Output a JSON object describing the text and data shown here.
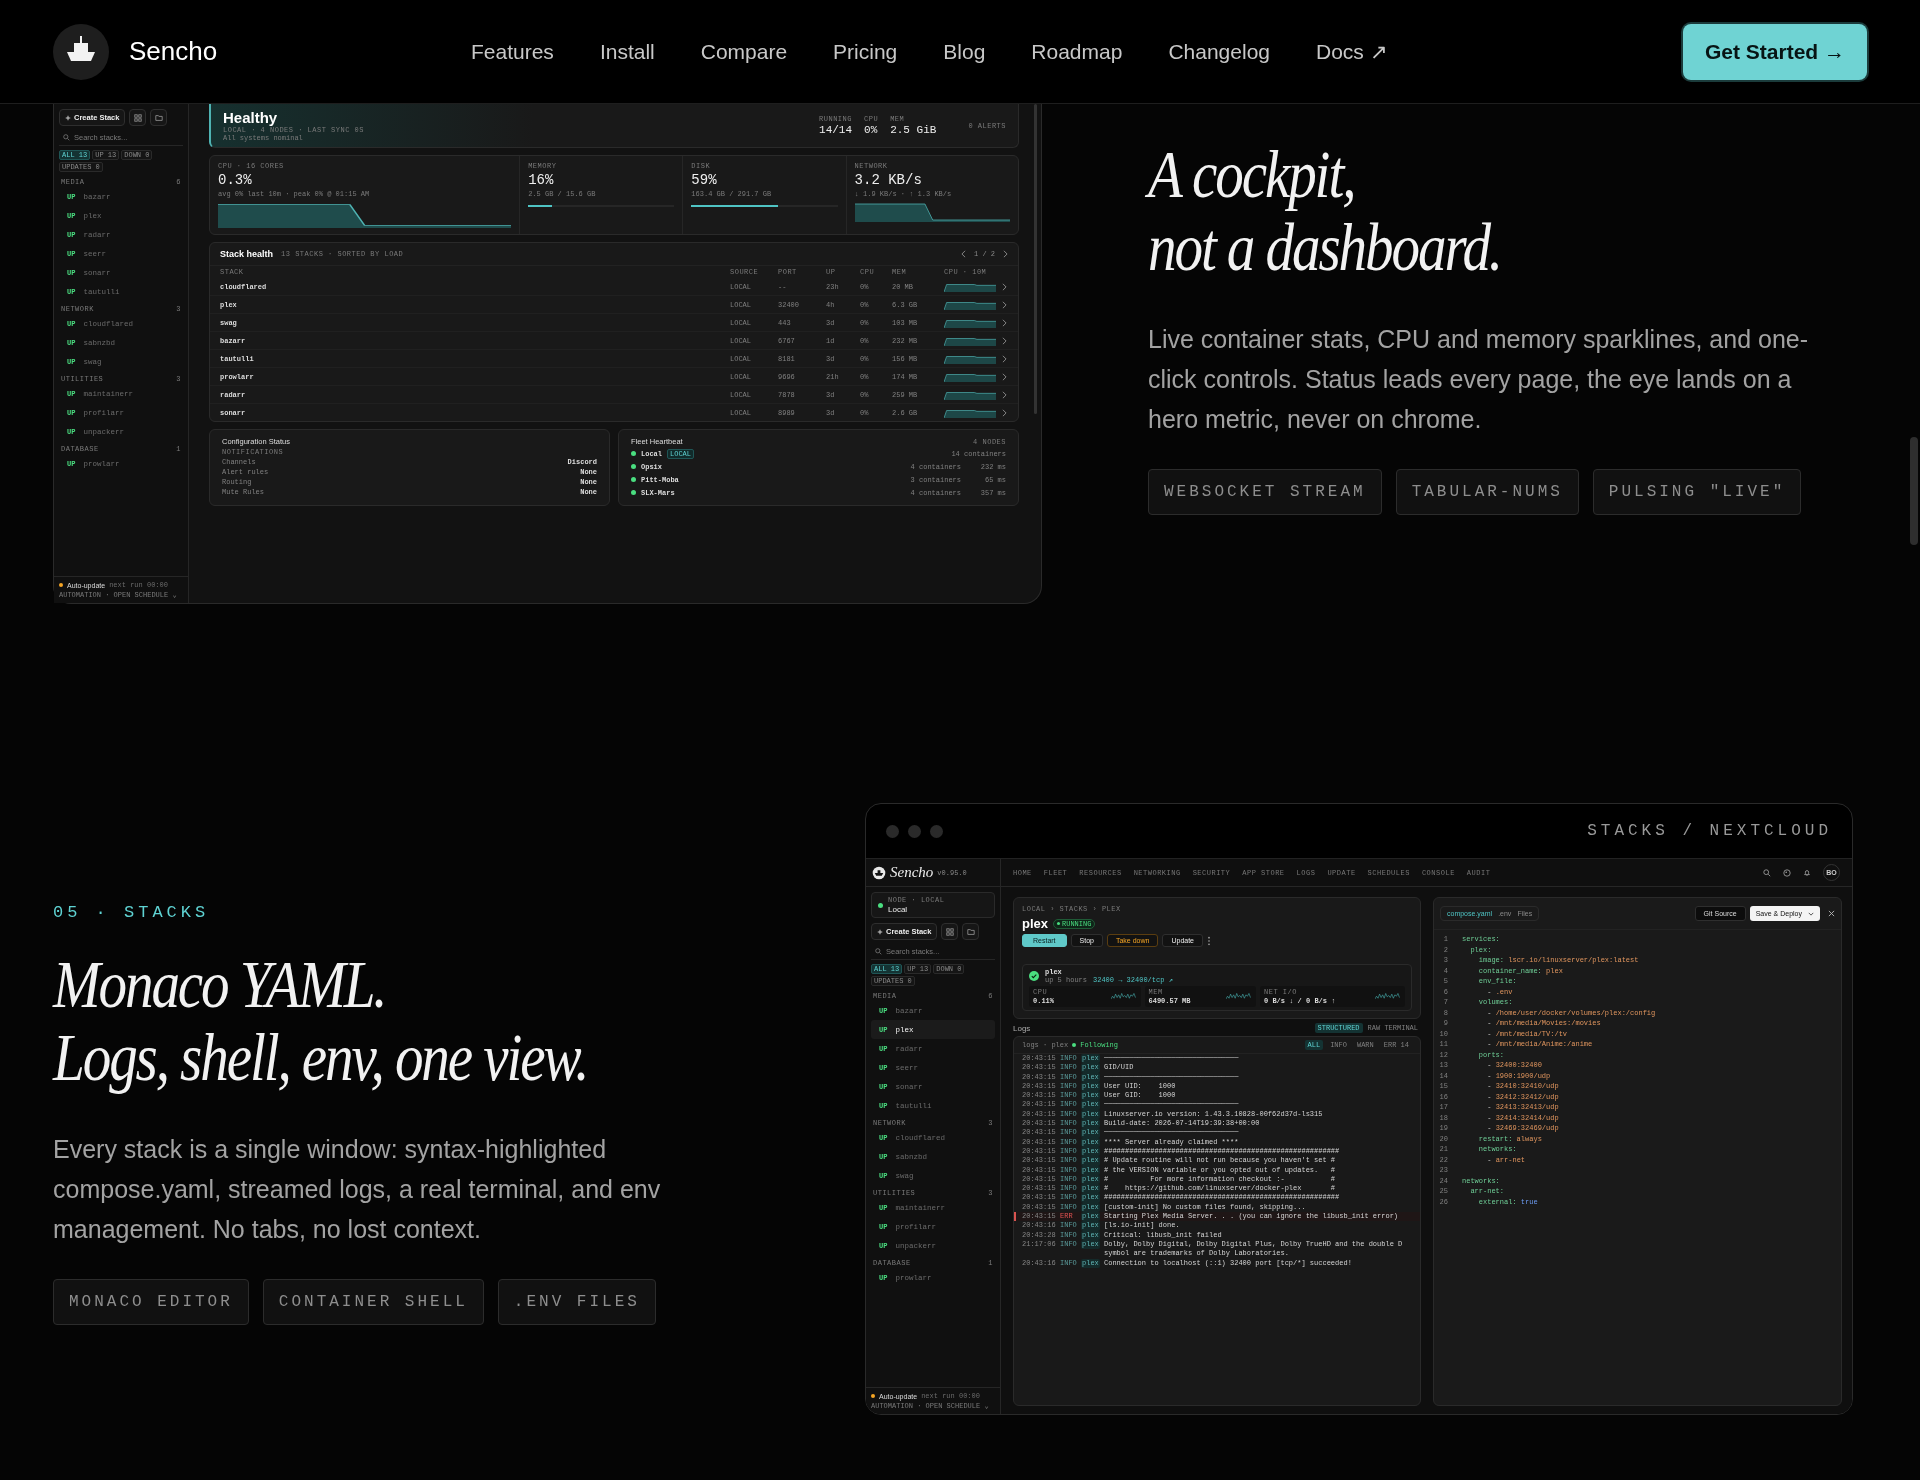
{
  "nav": {
    "brand": "Sencho",
    "links": [
      "Features",
      "Install",
      "Compare",
      "Pricing",
      "Blog",
      "Roadmap",
      "Changelog",
      "Docs ↗"
    ],
    "cta": "Get Started →"
  },
  "realtime": {
    "heading": [
      "A cockpit,",
      "not a dashboard."
    ],
    "body": "Live container stats, CPU and memory sparklines, and one-click controls. Status leads every page, the eye lands on a hero metric, never on chrome.",
    "tags": [
      "WEBSOCKET STREAM",
      "TABULAR-NUMS",
      "PULSING \"LIVE\""
    ],
    "preview": {
      "sidebar": {
        "create": "Create Stack",
        "search": {
          "placeholder": "Search stacks..."
        },
        "filters": [
          {
            "label": "ALL 13",
            "selected": true
          },
          {
            "label": "UP 13",
            "selected": false
          },
          {
            "label": "DOWN 0",
            "selected": false
          },
          {
            "label": "UPDATES 0",
            "selected": false
          }
        ],
        "groups": [
          {
            "name": "MEDIA",
            "count": "6",
            "items": [
              {
                "status": "UP",
                "name": "bazarr",
                "selected": false
              },
              {
                "status": "UP",
                "name": "plex",
                "selected": false
              },
              {
                "status": "UP",
                "name": "radarr",
                "selected": false
              },
              {
                "status": "UP",
                "name": "seerr",
                "selected": false
              },
              {
                "status": "UP",
                "name": "sonarr",
                "selected": false
              },
              {
                "status": "UP",
                "name": "tautulli",
                "selected": false
              }
            ]
          },
          {
            "name": "NETWORK",
            "count": "3",
            "items": [
              {
                "status": "UP",
                "name": "cloudflared",
                "selected": false
              },
              {
                "status": "UP",
                "name": "sabnzbd",
                "selected": false
              },
              {
                "status": "UP",
                "name": "swag",
                "selected": false
              }
            ]
          },
          {
            "name": "UTILITIES",
            "count": "3",
            "items": [
              {
                "status": "UP",
                "name": "maintainerr",
                "selected": false
              },
              {
                "status": "UP",
                "name": "profilarr",
                "selected": false
              },
              {
                "status": "UP",
                "name": "unpackerr",
                "selected": false
              }
            ]
          },
          {
            "name": "DATABASE",
            "count": "1",
            "items": [
              {
                "status": "UP",
                "name": "prowlarr",
                "selected": false
              }
            ]
          }
        ],
        "footer": {
          "title": "Auto-update",
          "next": "next run 00:00",
          "links": "AUTOMATION · OPEN SCHEDULE ⌄"
        }
      },
      "health": {
        "title": "Healthy",
        "meta": "LOCAL · 4 NODES · LAST SYNC 0S",
        "sub": "All systems nominal",
        "stats": [
          {
            "label": "RUNNING",
            "value": "14/14"
          },
          {
            "label": "CPU",
            "value": "0%"
          },
          {
            "label": "MEM",
            "value": "2.5 GiB"
          }
        ],
        "alerts": "0 ALERTS"
      },
      "metrics": [
        {
          "kind": "area",
          "label": "CPU · 16 CORES",
          "value": "0.3%",
          "sub": "avg 0% last 10m · peak 0% @ 01:15 AM"
        },
        {
          "kind": "bar",
          "label": "MEMORY",
          "value": "16%",
          "sub": "2.5 GB / 15.6 GB",
          "level": 0.16
        },
        {
          "kind": "bar",
          "label": "DISK",
          "value": "59%",
          "sub": "163.4 GB / 291.7 GB",
          "level": 0.59
        },
        {
          "kind": "area",
          "label": "NETWORK",
          "value": "3.2 KB/s",
          "sub": "↓ 1.9 KB/s · ↑ 1.3 KB/s"
        }
      ],
      "stack_health": {
        "title": "Stack health",
        "meta": "13 STACKS · SORTED BY LOAD",
        "pager": "1 / 2",
        "columns": [
          "STACK",
          "SOURCE",
          "PORT",
          "UP",
          "CPU",
          "MEM",
          "CPU · 10M"
        ],
        "rows": [
          [
            "cloudflared",
            "LOCAL",
            "--",
            "23h",
            "0%",
            "20 MB"
          ],
          [
            "plex",
            "LOCAL",
            "32400",
            "4h",
            "0%",
            "6.3 GB"
          ],
          [
            "swag",
            "LOCAL",
            "443",
            "3d",
            "0%",
            "103 MB"
          ],
          [
            "bazarr",
            "LOCAL",
            "6767",
            "1d",
            "0%",
            "232 MB"
          ],
          [
            "tautulli",
            "LOCAL",
            "8181",
            "3d",
            "0%",
            "156 MB"
          ],
          [
            "prowlarr",
            "LOCAL",
            "9696",
            "21h",
            "0%",
            "174 MB"
          ],
          [
            "radarr",
            "LOCAL",
            "7878",
            "3d",
            "0%",
            "259 MB"
          ],
          [
            "sonarr",
            "LOCAL",
            "8989",
            "3d",
            "0%",
            "2.6 GB"
          ]
        ]
      },
      "config": {
        "title": "Configuration Status",
        "section": "NOTIFICATIONS",
        "rows": [
          {
            "label": "Channels",
            "value": "Discord"
          },
          {
            "label": "Alert rules",
            "value": "None"
          },
          {
            "label": "Routing",
            "value": "None"
          },
          {
            "label": "Mute Rules",
            "value": "None"
          }
        ]
      },
      "fleet": {
        "title": "Fleet Heartbeat",
        "count": "4 NODES",
        "nodes": [
          {
            "name": "Local",
            "badge": "LOCAL",
            "containers": "14 containers"
          },
          {
            "name": "Opsix",
            "containers": "4 containers",
            "latency": "232 ms"
          },
          {
            "name": "Pitt-Moba",
            "containers": "3 containers",
            "latency": "65 ms"
          },
          {
            "name": "SLX-Mars",
            "containers": "4 containers",
            "latency": "357 ms"
          }
        ]
      }
    }
  },
  "stacks": {
    "kicker": "05 · STACKS",
    "heading": [
      "Monaco YAML.",
      "Logs, shell, env, one view."
    ],
    "body": "Every stack is a single window: syntax-highlighted compose.yaml, streamed logs, a real terminal, and env management. No tabs, no lost context.",
    "tags": [
      "MONACO EDITOR",
      "CONTAINER SHELL",
      ".ENV FILES"
    ],
    "window": {
      "title": "STACKS / NEXTCLOUD",
      "brand": "Sencho",
      "version": "v0.95.0",
      "tabs": [
        "HOME",
        "FLEET",
        "RESOURCES",
        "NETWORKING",
        "SECURITY",
        "APP STORE",
        "LOGS",
        "UPDATE",
        "SCHEDULES",
        "CONSOLE",
        "AUDIT"
      ],
      "avatar": "BO",
      "sidebar": {
        "node_label": "NODE · LOCAL",
        "node": "Local",
        "create": "Create Stack",
        "search": {
          "placeholder": "Search stacks..."
        },
        "filters": [
          {
            "label": "ALL 13",
            "selected": true
          },
          {
            "label": "UP 13",
            "selected": false
          },
          {
            "label": "DOWN 0",
            "selected": false
          },
          {
            "label": "UPDATES 0",
            "selected": false
          }
        ],
        "groups": [
          {
            "name": "MEDIA",
            "count": "6",
            "items": [
              {
                "status": "UP",
                "name": "bazarr",
                "selected": false
              },
              {
                "status": "UP",
                "name": "plex",
                "selected": true
              },
              {
                "status": "UP",
                "name": "radarr",
                "selected": false
              },
              {
                "status": "UP",
                "name": "seerr",
                "selected": false
              },
              {
                "status": "UP",
                "name": "sonarr",
                "selected": false
              },
              {
                "status": "UP",
                "name": "tautulli",
                "selected": false
              }
            ]
          },
          {
            "name": "NETWORK",
            "count": "3",
            "items": [
              {
                "status": "UP",
                "name": "cloudflared",
                "selected": false
              },
              {
                "status": "UP",
                "name": "sabnzbd",
                "selected": false
              },
              {
                "status": "UP",
                "name": "swag",
                "selected": false
              }
            ]
          },
          {
            "name": "UTILITIES",
            "count": "3",
            "items": [
              {
                "status": "UP",
                "name": "maintainerr",
                "selected": false
              },
              {
                "status": "UP",
                "name": "profilarr",
                "selected": false
              },
              {
                "status": "UP",
                "name": "unpackerr",
                "selected": false
              }
            ]
          },
          {
            "name": "DATABASE",
            "count": "1",
            "items": [
              {
                "status": "UP",
                "name": "prowlarr",
                "selected": false
              }
            ]
          }
        ],
        "footer": {
          "title": "Auto-update",
          "next": "next run 00:00",
          "links": "AUTOMATION · OPEN SCHEDULE ⌄"
        }
      },
      "stack": {
        "breadcrumb": "LOCAL › STACKS › PLEX",
        "name": "plex",
        "status": "RUNNING",
        "actions": [
          {
            "label": "Restart",
            "kind": "primary"
          },
          {
            "label": "Stop",
            "kind": "plain"
          },
          {
            "label": "Take down",
            "kind": "warning"
          },
          {
            "label": "Update",
            "kind": "plain"
          }
        ],
        "container": {
          "name": "plex",
          "uptime": "up 5 hours",
          "ports": "32400 → 32400/tcp ↗",
          "metrics": [
            {
              "label": "CPU",
              "value": "0.11%"
            },
            {
              "label": "MEM",
              "value": "6490.57 MB"
            },
            {
              "label": "NET I/O",
              "value": "0 B/s ↓ / 0 B/s ↑"
            }
          ]
        }
      },
      "logs": {
        "title": "Logs",
        "modes": [
          {
            "label": "STRUCTURED",
            "selected": true
          },
          {
            "label": "RAW TERMINAL",
            "selected": false
          }
        ],
        "source": "logs · plex",
        "following": "Following",
        "filters": [
          {
            "label": "ALL",
            "selected": true
          },
          {
            "label": "INFO",
            "selected": false
          },
          {
            "label": "WARN",
            "selected": false
          },
          {
            "label": "ERR 14",
            "selected": false
          }
        ],
        "lines": [
          {
            "time": "20:43:15",
            "severity": "INFO",
            "source": "plex",
            "msg": "────────────────────────────────"
          },
          {
            "time": "20:43:15",
            "severity": "INFO",
            "source": "plex",
            "msg": "GID/UID"
          },
          {
            "time": "20:43:15",
            "severity": "INFO",
            "source": "plex",
            "msg": "────────────────────────────────"
          },
          {
            "time": "20:43:15",
            "severity": "INFO",
            "source": "plex",
            "msg": "User UID:    1000"
          },
          {
            "time": "20:43:15",
            "severity": "INFO",
            "source": "plex",
            "msg": "User GID:    1000"
          },
          {
            "time": "20:43:15",
            "severity": "INFO",
            "source": "plex",
            "msg": "────────────────────────────────"
          },
          {
            "time": "20:43:15",
            "severity": "INFO",
            "source": "plex",
            "msg": "Linuxserver.io version: 1.43.3.10828-00f62d37d-ls315"
          },
          {
            "time": "20:43:15",
            "severity": "INFO",
            "source": "plex",
            "msg": "Build-date: 2026-07-14T19:39:38+00:00"
          },
          {
            "time": "20:43:15",
            "severity": "INFO",
            "source": "plex",
            "msg": "────────────────────────────────"
          },
          {
            "time": "20:43:15",
            "severity": "INFO",
            "source": "plex",
            "msg": "**** Server already claimed ****"
          },
          {
            "time": "20:43:15",
            "severity": "INFO",
            "source": "plex",
            "msg": "########################################################"
          },
          {
            "time": "20:43:15",
            "severity": "INFO",
            "source": "plex",
            "msg": "# Update routine will not run because you haven't set #"
          },
          {
            "time": "20:43:15",
            "severity": "INFO",
            "source": "plex",
            "msg": "# the VERSION variable or you opted out of updates.   #"
          },
          {
            "time": "20:43:15",
            "severity": "INFO",
            "source": "plex",
            "msg": "#          For more information checkout :-           #"
          },
          {
            "time": "20:43:15",
            "severity": "INFO",
            "source": "plex",
            "msg": "#    https://github.com/linuxserver/docker-plex       #"
          },
          {
            "time": "20:43:15",
            "severity": "INFO",
            "source": "plex",
            "msg": "########################################################"
          },
          {
            "time": "20:43:15",
            "severity": "INFO",
            "source": "plex",
            "msg": "[custom-init] No custom files found, skipping..."
          },
          {
            "time": "20:43:15",
            "severity": "ERR",
            "source": "plex",
            "msg": "Starting Plex Media Server. . . (you can ignore the libusb_init error)"
          },
          {
            "time": "20:43:16",
            "severity": "INFO",
            "source": "plex",
            "msg": "[ls.io-init] done."
          },
          {
            "time": "20:43:28",
            "severity": "INFO",
            "source": "plex",
            "msg": "Critical: libusb_init failed"
          },
          {
            "time": "21:17:06",
            "severity": "INFO",
            "source": "plex",
            "msg": "Dolby, Dolby Digital, Dolby Digital Plus, Dolby TrueHD and the double D symbol are trademarks of Dolby Laboratories."
          },
          {
            "time": "20:43:16",
            "severity": "INFO",
            "source": "plex",
            "msg": "Connection to localhost (::1) 32400 port [tcp/*] succeeded!"
          }
        ]
      },
      "editor": {
        "tabs": [
          {
            "label": "compose.yaml",
            "selected": true
          },
          {
            "label": ".env",
            "selected": false
          },
          {
            "label": "Files",
            "selected": false
          }
        ],
        "git": "Git Source",
        "save": "Save & Deploy",
        "lines": [
          {
            "n": "1",
            "kind": "key",
            "code": "services:"
          },
          {
            "n": "2",
            "kind": "key",
            "code": "  plex:"
          },
          {
            "n": "3",
            "kind": "key",
            "code": "    image: lscr.io/linuxserver/plex:latest"
          },
          {
            "n": "4",
            "kind": "key",
            "code": "    container_name: plex"
          },
          {
            "n": "5",
            "kind": "key",
            "code": "    env_file:"
          },
          {
            "n": "6",
            "kind": "item",
            "code": "      - .env"
          },
          {
            "n": "7",
            "kind": "key",
            "code": "    volumes:"
          },
          {
            "n": "8",
            "kind": "item",
            "code": "      - /home/user/docker/volumes/plex:/config"
          },
          {
            "n": "9",
            "kind": "item",
            "code": "      - /mnt/media/Movies:/movies"
          },
          {
            "n": "10",
            "kind": "item",
            "code": "      - /mnt/media/TV:/tv"
          },
          {
            "n": "11",
            "kind": "item",
            "code": "      - /mnt/media/Anime:/anime"
          },
          {
            "n": "12",
            "kind": "key",
            "code": "    ports:"
          },
          {
            "n": "13",
            "kind": "item",
            "code": "      - 32400:32400"
          },
          {
            "n": "14",
            "kind": "item",
            "code": "      - 1900:1900/udp"
          },
          {
            "n": "15",
            "kind": "item",
            "code": "      - 32410:32410/udp"
          },
          {
            "n": "16",
            "kind": "item",
            "code": "      - 32412:32412/udp"
          },
          {
            "n": "17",
            "kind": "item",
            "code": "      - 32413:32413/udp"
          },
          {
            "n": "18",
            "kind": "item",
            "code": "      - 32414:32414/udp"
          },
          {
            "n": "19",
            "kind": "item",
            "code": "      - 32469:32469/udp"
          },
          {
            "n": "20",
            "kind": "key",
            "code": "    restart: always"
          },
          {
            "n": "21",
            "kind": "key",
            "code": "    networks:"
          },
          {
            "n": "22",
            "kind": "item",
            "code": "      - arr-net"
          },
          {
            "n": "23",
            "kind": "blank"
          },
          {
            "n": "24",
            "kind": "key",
            "code": "networks:"
          },
          {
            "n": "25",
            "kind": "key",
            "code": "  arr-net:"
          },
          {
            "n": "26",
            "kind": "flag",
            "code": "    external: true"
          }
        ]
      }
    }
  }
}
